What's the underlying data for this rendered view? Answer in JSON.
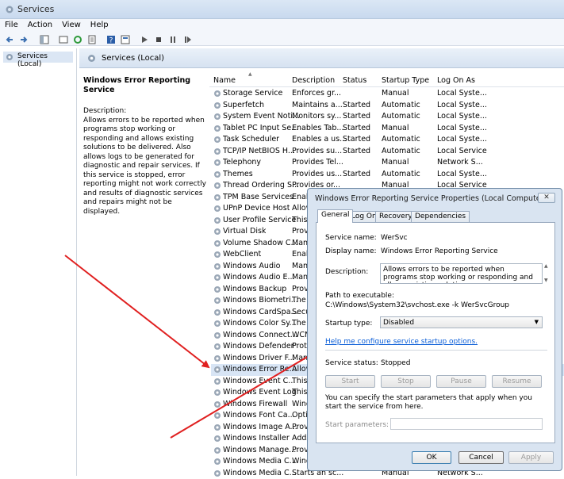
{
  "window": {
    "title": "Services"
  },
  "menu": [
    "File",
    "Action",
    "View",
    "Help"
  ],
  "tree": {
    "root": "Services (Local)"
  },
  "header": {
    "title": "Services (Local)"
  },
  "detail": {
    "service_name": "Windows Error Reporting Service",
    "description_label": "Description:",
    "description": "Allows errors to be reported when programs stop working or responding and allows existing solutions to be delivered. Also allows logs to be generated for diagnostic and repair services. If this service is stopped, error reporting might not work correctly and results of diagnostic services and repairs might not be displayed."
  },
  "columns": [
    "Name",
    "Description",
    "Status",
    "Startup Type",
    "Log On As"
  ],
  "services": [
    {
      "name": "Storage Service",
      "desc": "Enforces gr...",
      "status": "",
      "startup": "Manual",
      "logon": "Local Syste..."
    },
    {
      "name": "Superfetch",
      "desc": "Maintains a...",
      "status": "Started",
      "startup": "Automatic",
      "logon": "Local Syste..."
    },
    {
      "name": "System Event Noti...",
      "desc": "Monitors sy...",
      "status": "Started",
      "startup": "Automatic",
      "logon": "Local Syste..."
    },
    {
      "name": "Tablet PC Input Se...",
      "desc": "Enables Tab...",
      "status": "Started",
      "startup": "Manual",
      "logon": "Local Syste..."
    },
    {
      "name": "Task Scheduler",
      "desc": "Enables a us...",
      "status": "Started",
      "startup": "Automatic",
      "logon": "Local Syste..."
    },
    {
      "name": "TCP/IP NetBIOS H...",
      "desc": "Provides su...",
      "status": "Started",
      "startup": "Automatic",
      "logon": "Local Service"
    },
    {
      "name": "Telephony",
      "desc": "Provides Tel...",
      "status": "",
      "startup": "Manual",
      "logon": "Network S..."
    },
    {
      "name": "Themes",
      "desc": "Provides us...",
      "status": "Started",
      "startup": "Automatic",
      "logon": "Local Syste..."
    },
    {
      "name": "Thread Ordering S...",
      "desc": "Provides or...",
      "status": "",
      "startup": "Manual",
      "logon": "Local Service"
    },
    {
      "name": "TPM Base Services",
      "desc": "Enab",
      "status": "",
      "startup": "",
      "logon": ""
    },
    {
      "name": "UPnP Device Host",
      "desc": "Allov",
      "status": "",
      "startup": "",
      "logon": ""
    },
    {
      "name": "User Profile Service",
      "desc": "This",
      "status": "",
      "startup": "",
      "logon": ""
    },
    {
      "name": "Virtual Disk",
      "desc": "Provi",
      "status": "",
      "startup": "",
      "logon": ""
    },
    {
      "name": "Volume Shadow C...",
      "desc": "Mana",
      "status": "",
      "startup": "",
      "logon": ""
    },
    {
      "name": "WebClient",
      "desc": "Enab",
      "status": "",
      "startup": "",
      "logon": ""
    },
    {
      "name": "Windows Audio",
      "desc": "Mana",
      "status": "",
      "startup": "",
      "logon": ""
    },
    {
      "name": "Windows Audio E...",
      "desc": "Mana",
      "status": "",
      "startup": "",
      "logon": ""
    },
    {
      "name": "Windows Backup",
      "desc": "Provi",
      "status": "",
      "startup": "",
      "logon": ""
    },
    {
      "name": "Windows Biometri...",
      "desc": "The V",
      "status": "",
      "startup": "",
      "logon": ""
    },
    {
      "name": "Windows CardSpa...",
      "desc": "Secu",
      "status": "",
      "startup": "",
      "logon": ""
    },
    {
      "name": "Windows Color Sy...",
      "desc": "The V",
      "status": "",
      "startup": "",
      "logon": ""
    },
    {
      "name": "Windows Connect...",
      "desc": "WCN",
      "status": "",
      "startup": "",
      "logon": ""
    },
    {
      "name": "Windows Defender",
      "desc": "Prote",
      "status": "",
      "startup": "",
      "logon": ""
    },
    {
      "name": "Windows Driver F...",
      "desc": "Mana",
      "status": "",
      "startup": "",
      "logon": ""
    },
    {
      "name": "Windows Error Re...",
      "desc": "Allov",
      "status": "",
      "startup": "",
      "logon": ""
    },
    {
      "name": "Windows Event C...",
      "desc": "This",
      "status": "",
      "startup": "",
      "logon": ""
    },
    {
      "name": "Windows Event Log",
      "desc": "This",
      "status": "",
      "startup": "",
      "logon": ""
    },
    {
      "name": "Windows Firewall",
      "desc": "Wind",
      "status": "",
      "startup": "",
      "logon": ""
    },
    {
      "name": "Windows Font Ca...",
      "desc": "Optir",
      "status": "",
      "startup": "",
      "logon": ""
    },
    {
      "name": "Windows Image A...",
      "desc": "Provi",
      "status": "",
      "startup": "",
      "logon": ""
    },
    {
      "name": "Windows Installer",
      "desc": "Adds",
      "status": "",
      "startup": "",
      "logon": ""
    },
    {
      "name": "Windows Manage...",
      "desc": "Provi",
      "status": "",
      "startup": "",
      "logon": ""
    },
    {
      "name": "Windows Media C...",
      "desc": "Wind",
      "status": "",
      "startup": "",
      "logon": ""
    },
    {
      "name": "Windows Media C...",
      "desc": "Starts an sc...",
      "status": "",
      "startup": "Manual",
      "logon": "Network S..."
    }
  ],
  "dialog": {
    "title": "Windows Error Reporting Service Properties (Local Computer)",
    "close": "✕",
    "tabs": [
      "General",
      "Log On",
      "Recovery",
      "Dependencies"
    ],
    "service_name_label": "Service name:",
    "service_name": "WerSvc",
    "display_name_label": "Display name:",
    "display_name": "Windows Error Reporting Service",
    "description_label": "Description:",
    "description": "Allows errors to be reported when programs stop working or responding and allows existing solutions",
    "path_label": "Path to executable:",
    "path": "C:\\Windows\\System32\\svchost.exe -k WerSvcGroup",
    "startup_label": "Startup type:",
    "startup_value": "Disabled",
    "help_link": "Help me configure service startup options.",
    "status_label": "Service status:",
    "status_value": "Stopped",
    "buttons": {
      "start": "Start",
      "stop": "Stop",
      "pause": "Pause",
      "resume": "Resume"
    },
    "params_note": "You can specify the start parameters that apply when you start the service from here.",
    "params_label": "Start parameters:",
    "ok": "OK",
    "cancel": "Cancel",
    "apply": "Apply"
  },
  "colors": {
    "arrow": "#e02020",
    "selection": "#d8e5f5",
    "link": "#0b5ed7"
  }
}
